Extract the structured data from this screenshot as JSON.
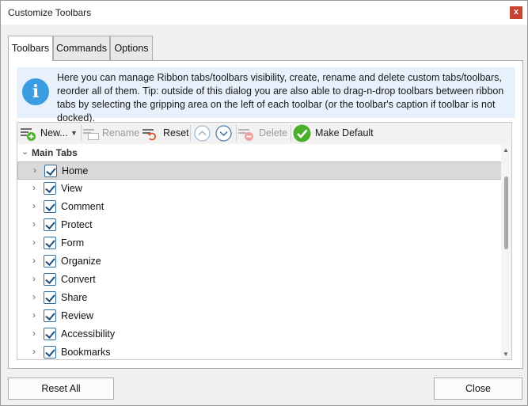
{
  "window": {
    "title": "Customize Toolbars",
    "close_label": "x"
  },
  "tabs": [
    {
      "label": "Toolbars"
    },
    {
      "label": "Commands"
    },
    {
      "label": "Options"
    }
  ],
  "info": {
    "icon": "info-icon",
    "icon_glyph": "i",
    "text": "Here you can manage Ribbon tabs/toolbars visibility, create, rename and delete custom tabs/toolbars, reorder all of them. Tip: outside of this dialog you are also able to drag-n-drop toolbars between ribbon tabs by selecting the gripping area on the left of each toolbar (or the toolbar's caption if toolbar is not docked)."
  },
  "toolbar": {
    "new_label": "New...",
    "rename_label": "Rename",
    "reset_label": "Reset",
    "delete_label": "Delete",
    "make_default_label": "Make Default"
  },
  "tree": {
    "group_label": "Main Tabs",
    "items": [
      {
        "label": "Home",
        "checked": true,
        "selected": true
      },
      {
        "label": "View",
        "checked": true
      },
      {
        "label": "Comment",
        "checked": true
      },
      {
        "label": "Protect",
        "checked": true
      },
      {
        "label": "Form",
        "checked": true
      },
      {
        "label": "Organize",
        "checked": true
      },
      {
        "label": "Convert",
        "checked": true
      },
      {
        "label": "Share",
        "checked": true
      },
      {
        "label": "Review",
        "checked": true
      },
      {
        "label": "Accessibility",
        "checked": true
      },
      {
        "label": "Bookmarks",
        "checked": true
      }
    ]
  },
  "footer": {
    "reset_all_label": "Reset All",
    "close_label": "Close"
  },
  "colors": {
    "accent": "#3a9de2",
    "close_button": "#c84031",
    "info_background": "#e6f1fb",
    "make_default_green": "#4caf2a",
    "reset_arrow": "#e0542b"
  }
}
